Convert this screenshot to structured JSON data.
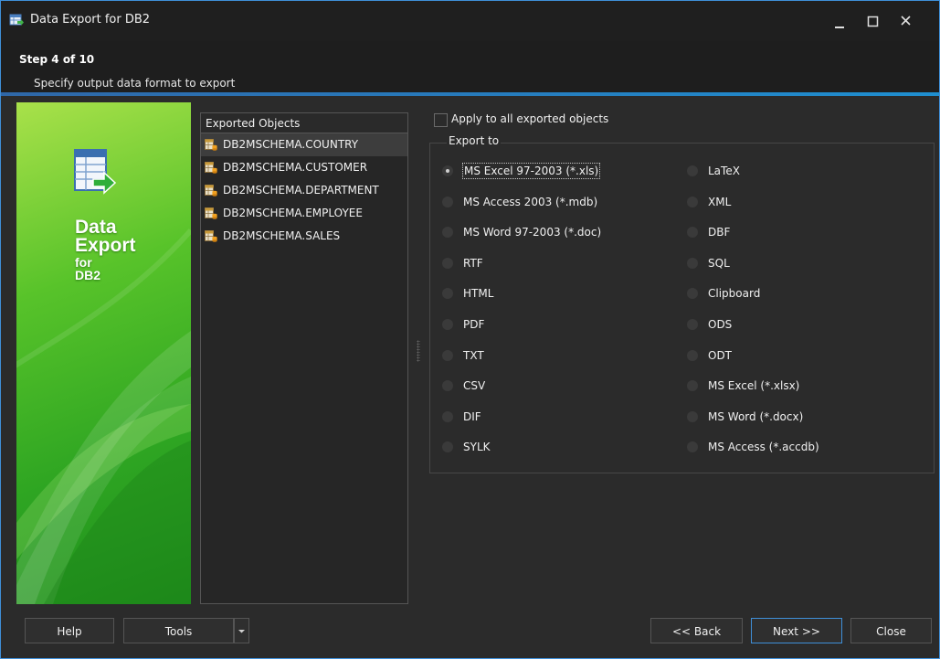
{
  "window": {
    "title": "Data Export for DB2",
    "controls": {
      "minimize": "minimize",
      "maximize": "maximize",
      "close": "close"
    }
  },
  "header": {
    "step": "Step 4 of 10",
    "subtitle": "Specify output data format to export"
  },
  "banner": {
    "line1": "Data",
    "line2": "Export",
    "line3": "for",
    "line4": "DB2",
    "icon": "table-export-icon"
  },
  "objects": {
    "header": "Exported Objects",
    "items": [
      "DB2MSCHEMA.COUNTRY",
      "DB2MSCHEMA.CUSTOMER",
      "DB2MSCHEMA.DEPARTMENT",
      "DB2MSCHEMA.EMPLOYEE",
      "DB2MSCHEMA.SALES"
    ],
    "selected_index": 0
  },
  "apply": {
    "label": "Apply to all exported objects",
    "checked": false
  },
  "export": {
    "title": "Export to",
    "left": [
      "MS Excel 97-2003 (*.xls)",
      "MS Access 2003 (*.mdb)",
      "MS Word 97-2003 (*.doc)",
      "RTF",
      "HTML",
      "PDF",
      "TXT",
      "CSV",
      "DIF",
      "SYLK"
    ],
    "right": [
      "LaTeX",
      "XML",
      "DBF",
      "SQL",
      "Clipboard",
      "ODS",
      "ODT",
      "MS Excel (*.xlsx)",
      "MS Word (*.docx)",
      "MS Access  (*.accdb)"
    ],
    "selected": "MS Excel 97-2003 (*.xls)"
  },
  "buttons": {
    "help": "Help",
    "tools": "Tools",
    "back": "<< Back",
    "next": "Next >>",
    "close": "Close"
  },
  "colors": {
    "accent": "#3f8fd8",
    "banner_green": "#4cbf2a",
    "background": "#2b2b2b"
  }
}
